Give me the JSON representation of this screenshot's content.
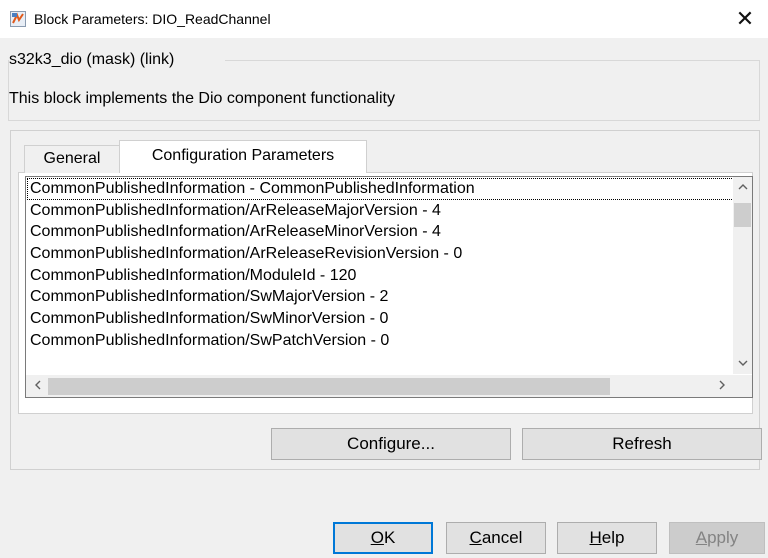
{
  "window": {
    "title": "Block Parameters: DIO_ReadChannel",
    "close_glyph": "✕"
  },
  "mask": {
    "header": "s32k3_dio (mask) (link)",
    "description": "This block implements the Dio component functionality"
  },
  "tabs": [
    {
      "label": "General",
      "active": false
    },
    {
      "label": "Configuration Parameters",
      "active": true
    }
  ],
  "list": {
    "items": [
      "CommonPublishedInformation - CommonPublishedInformation",
      "CommonPublishedInformation/ArReleaseMajorVersion - 4",
      "CommonPublishedInformation/ArReleaseMinorVersion - 4",
      "CommonPublishedInformation/ArReleaseRevisionVersion - 0",
      "CommonPublishedInformation/ModuleId - 120",
      "CommonPublishedInformation/SwMajorVersion - 2",
      "CommonPublishedInformation/SwMinorVersion - 0",
      "CommonPublishedInformation/SwPatchVersion - 0"
    ]
  },
  "buttons": {
    "configure": "Configure...",
    "refresh": "Refresh",
    "ok_mnemonic": "O",
    "ok_rest": "K",
    "cancel_mnemonic": "C",
    "cancel_rest": "ancel",
    "help_mnemonic": "H",
    "help_rest": "elp",
    "apply_mnemonic": "A",
    "apply_rest": "pply"
  },
  "scroll_icons": {
    "up": "chevron-up-icon",
    "down": "chevron-down-icon",
    "left": "chevron-left-icon",
    "right": "chevron-right-icon"
  },
  "colors": {
    "default_button_border": "#0078d7",
    "scroll_thumb": "#cdcdcd"
  }
}
